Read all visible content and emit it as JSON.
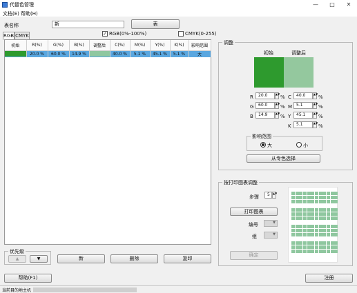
{
  "window": {
    "title": "代替色管理",
    "minimize": "—",
    "maximize": "□",
    "close": "✕"
  },
  "menu": {
    "file": "文档(E)",
    "help": "帮助(H)"
  },
  "table_name": {
    "label": "表名称",
    "value": "新",
    "button": "表"
  },
  "tabs": {
    "rgb": "RGB",
    "cmyk": "CMYK"
  },
  "mode_checks": {
    "rgb": "RGB(0%-100%)",
    "cmyk": "CMYK(0-255)",
    "rgb_checked": true,
    "cmyk_checked": false
  },
  "color_table": {
    "headers": [
      "初始",
      "R(%)",
      "G(%)",
      "B(%)",
      "调整后",
      "C(%)",
      "M(%)",
      "Y(%)",
      "K(%)",
      "影响范围"
    ],
    "rows": [
      {
        "r": "20.0 %",
        "g": "60.0 %",
        "b": "14.9 %",
        "c": "40.0 %",
        "m": "5.1 %",
        "y": "45.1 %",
        "k": "5.1 %",
        "range": "大",
        "initial_color": "#2e9a2e",
        "adjusted_color": "#8fc79f"
      }
    ]
  },
  "adjust": {
    "title": "调整",
    "initial_label": "初始",
    "adjusted_label": "调整后",
    "initial_color": "#2e9a2e",
    "adjusted_color": "#94c89e",
    "r_label": "R",
    "r_value": "20.0",
    "g_label": "G",
    "g_value": "60.0",
    "b_label": "B",
    "b_value": "14.9",
    "c_label": "C",
    "c_value": "40.0",
    "m_label": "M",
    "m_value": "5.1",
    "y_label": "Y",
    "y_value": "45.1",
    "k_label": "K",
    "k_value": "5.1",
    "pct": "%",
    "range_title": "影响范围",
    "range_large": "大",
    "range_small": "小",
    "spot_button": "从专色选择"
  },
  "print_adjust": {
    "title": "按打印图表调整",
    "step_label": "步骤",
    "step_value": "5",
    "print_button": "打印图表",
    "number_label": "编号",
    "group_label": "组",
    "confirm_button": "确定",
    "swatch_color": "#8fc79f"
  },
  "priority": {
    "title": "优先级",
    "up": "▲",
    "down": "▼"
  },
  "actions": {
    "new": "新",
    "delete": "删除",
    "copy": "复印"
  },
  "footer": {
    "help": "帮助(F1)",
    "register": "注册"
  },
  "status": {
    "text": "当前目的地主机"
  }
}
